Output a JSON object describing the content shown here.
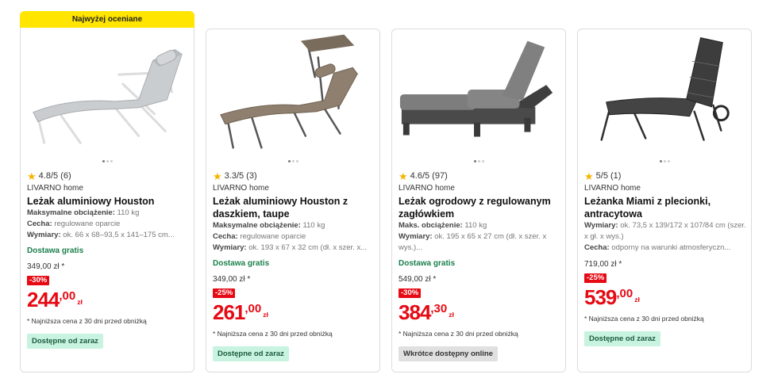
{
  "products": [
    {
      "badge": "Najwyżej oceniane",
      "rating": "4.8/5 (6)",
      "brand": "LIVARNO home",
      "title": "Leżak aluminiowy Houston",
      "specs": [
        {
          "label": "Maksymalne obciążenie:",
          "value": "110 kg"
        },
        {
          "label": "Cecha:",
          "value": "regulowane oparcie"
        },
        {
          "label": "Wymiary:",
          "value": "ok. 66 x 68–93,5 x 141–175 cm..."
        }
      ],
      "delivery": "Dostawa gratis",
      "old_price": "349,00 zł *",
      "discount": "-30%",
      "price_int": "244",
      "price_cents": ",00",
      "currency": "zł",
      "note": "* Najniższa cena z 30 dni przed obniżką",
      "availability": "Dostępne od zaraz",
      "availability_color": "#c7f3e0"
    },
    {
      "rating": "3.3/5 (3)",
      "brand": "LIVARNO home",
      "title": "Leżak aluminiowy Houston z daszkiem, taupe",
      "specs": [
        {
          "label": "Maksymalne obciążenie:",
          "value": "110 kg"
        },
        {
          "label": "Cecha:",
          "value": "regulowane oparcie"
        },
        {
          "label": "Wymiary:",
          "value": "ok. 193 x 67 x 32 cm (dł. x szer. x..."
        }
      ],
      "delivery": "Dostawa gratis",
      "old_price": "349,00 zł *",
      "discount": "-25%",
      "price_int": "261",
      "price_cents": ",00",
      "currency": "zł",
      "note": "* Najniższa cena z 30 dni przed obniżką",
      "availability": "Dostępne od zaraz",
      "availability_color": "#c7f3e0"
    },
    {
      "rating": "4.6/5 (97)",
      "brand": "LIVARNO home",
      "title": "Leżak ogrodowy z regulowanym zagłówkiem",
      "specs": [
        {
          "label": "Maks. obciążenie:",
          "value": "110 kg"
        },
        {
          "label": "Wymiary:",
          "value": "ok. 195 x 65 x 27 cm (dł. x szer. x wys.)..."
        }
      ],
      "delivery": "Dostawa gratis",
      "old_price": "549,00 zł *",
      "discount": "-30%",
      "price_int": "384",
      "price_cents": ",30",
      "currency": "zł",
      "note": "* Najniższa cena z 30 dni przed obniżką",
      "availability": "Wkrótce dostępny online",
      "availability_color": "#e0e0e0"
    },
    {
      "rating": "5/5 (1)",
      "brand": "LIVARNO home",
      "title": "Leżanka Miami z plecionki, antracytowa",
      "specs": [
        {
          "label": "Wymiary:",
          "value": "ok. 73,5 x 139/172 x 107/84 cm (szer. x gł. x wys.)"
        },
        {
          "label": "Cecha:",
          "value": "odporny na warunki atmosferyczn..."
        }
      ],
      "old_price": "719,00 zł *",
      "discount": "-25%",
      "price_int": "539",
      "price_cents": ",00",
      "currency": "zł",
      "note": "* Najniższa cena z 30 dni przed obniżką",
      "availability": "Dostępne od zaraz",
      "availability_color": "#c7f3e0"
    }
  ]
}
